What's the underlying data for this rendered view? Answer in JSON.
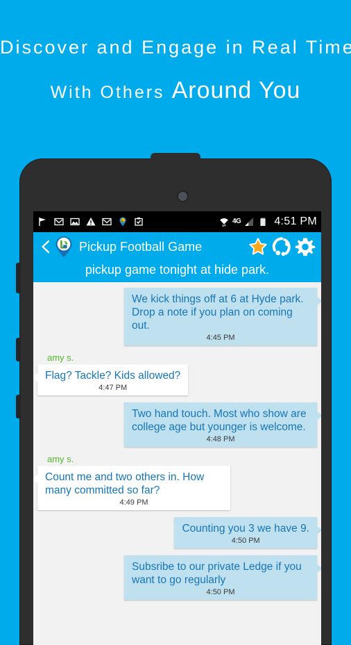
{
  "promo": {
    "line1": "Discover  and  Engage  in  Real  Time",
    "line2_small": "With  Others",
    "line2_big": "Around You"
  },
  "colors": {
    "brand_blue": "#00ABEC",
    "outgoing_bubble": "#bfe0ee",
    "incoming_bubble": "#ffffff",
    "message_text": "#1676b8",
    "sender_green": "#55b92c",
    "star_gold": "#F9A81A"
  },
  "statusbar": {
    "left_icons": [
      "flag-icon",
      "gmail-icon",
      "image-icon",
      "warning-triangle-icon",
      "gmail-icon",
      "location-pin-icon",
      "clipboard-check-icon"
    ],
    "wifi_icon": "wifi-icon",
    "network_label": "4G",
    "signal_icon": "signal-bars-icon",
    "battery_icon": "battery-icon",
    "time": "4:51 PM"
  },
  "appbar": {
    "back_icon": "back-chevron-icon",
    "logo_icon": "app-logo-pin-icon",
    "title": "Pickup Football Game",
    "star_icon": "star-icon",
    "share_icon": "share-circle-icon",
    "settings_icon": "gear-icon"
  },
  "subtitle": "pickup game tonight at hide park.",
  "messages": [
    {
      "direction": "out",
      "sender": "",
      "text": "We kick things off at 6 at Hyde park. Drop a note if you plan on coming out.",
      "time": "4:45 PM"
    },
    {
      "direction": "in",
      "sender": "amy s.",
      "text": "Flag? Tackle? Kids allowed?",
      "time": "4:47 PM"
    },
    {
      "direction": "out",
      "sender": "",
      "text": "Two hand touch. Most who show are college age but younger is welcome.",
      "time": "4:48 PM"
    },
    {
      "direction": "in",
      "sender": "amy s.",
      "text": "Count me and two others in. How many committed so far?",
      "time": "4:49 PM"
    },
    {
      "direction": "out",
      "sender": "",
      "text": "Counting you 3 we have 9.",
      "time": "4:50 PM"
    },
    {
      "direction": "out",
      "sender": "",
      "text": "Subsribe to our private Ledge if you want to go regularly",
      "time": "4:50 PM"
    }
  ]
}
